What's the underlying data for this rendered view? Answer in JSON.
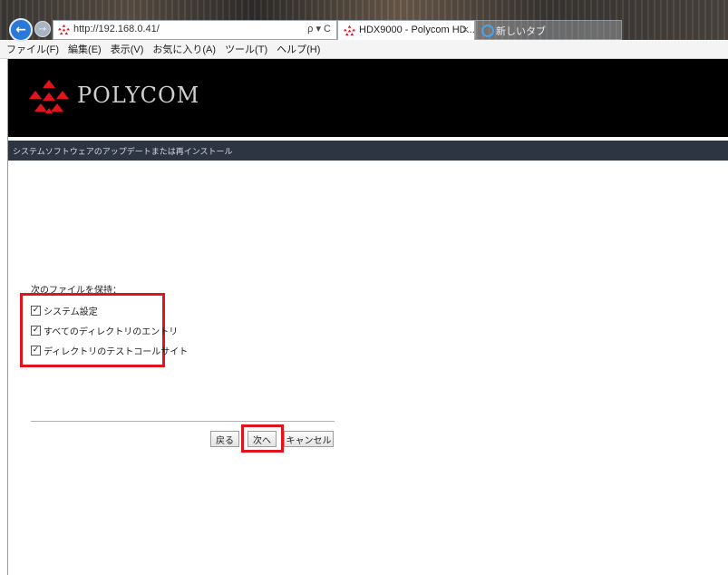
{
  "browser": {
    "address_url": "http://192.168.0.41/",
    "address_tools": "ρ ▾ C",
    "tab_active_title": "HDX9000 - Polycom HD...",
    "tab_close": "×",
    "tab_new_title": "新しいタブ",
    "menu": [
      "ファイル(F)",
      "編集(E)",
      "表示(V)",
      "お気に入り(A)",
      "ツール(T)",
      "ヘルプ(H)"
    ]
  },
  "header": {
    "logo_text": "POLYCOM",
    "brand_color": "#e0141c"
  },
  "subbar": {
    "title": "システムソフトウェアのアップデートまたは再インストール"
  },
  "form": {
    "keep_label": "次のファイルを保持：",
    "options": [
      {
        "label": "システム設定",
        "checked": true
      },
      {
        "label": "すべてのディレクトリのエントリ",
        "checked": true
      },
      {
        "label": "ディレクトリのテストコールサイト",
        "checked": true
      }
    ],
    "check_glyph": "✓",
    "buttons": {
      "back": "戻る",
      "next": "次へ",
      "cancel": "キャンセル"
    }
  },
  "icons": [
    "back-arrow-icon",
    "forward-arrow-icon",
    "polycom-favicon",
    "ie-icon",
    "polycom-logo-icon"
  ],
  "highlight_color": "#e0141c"
}
